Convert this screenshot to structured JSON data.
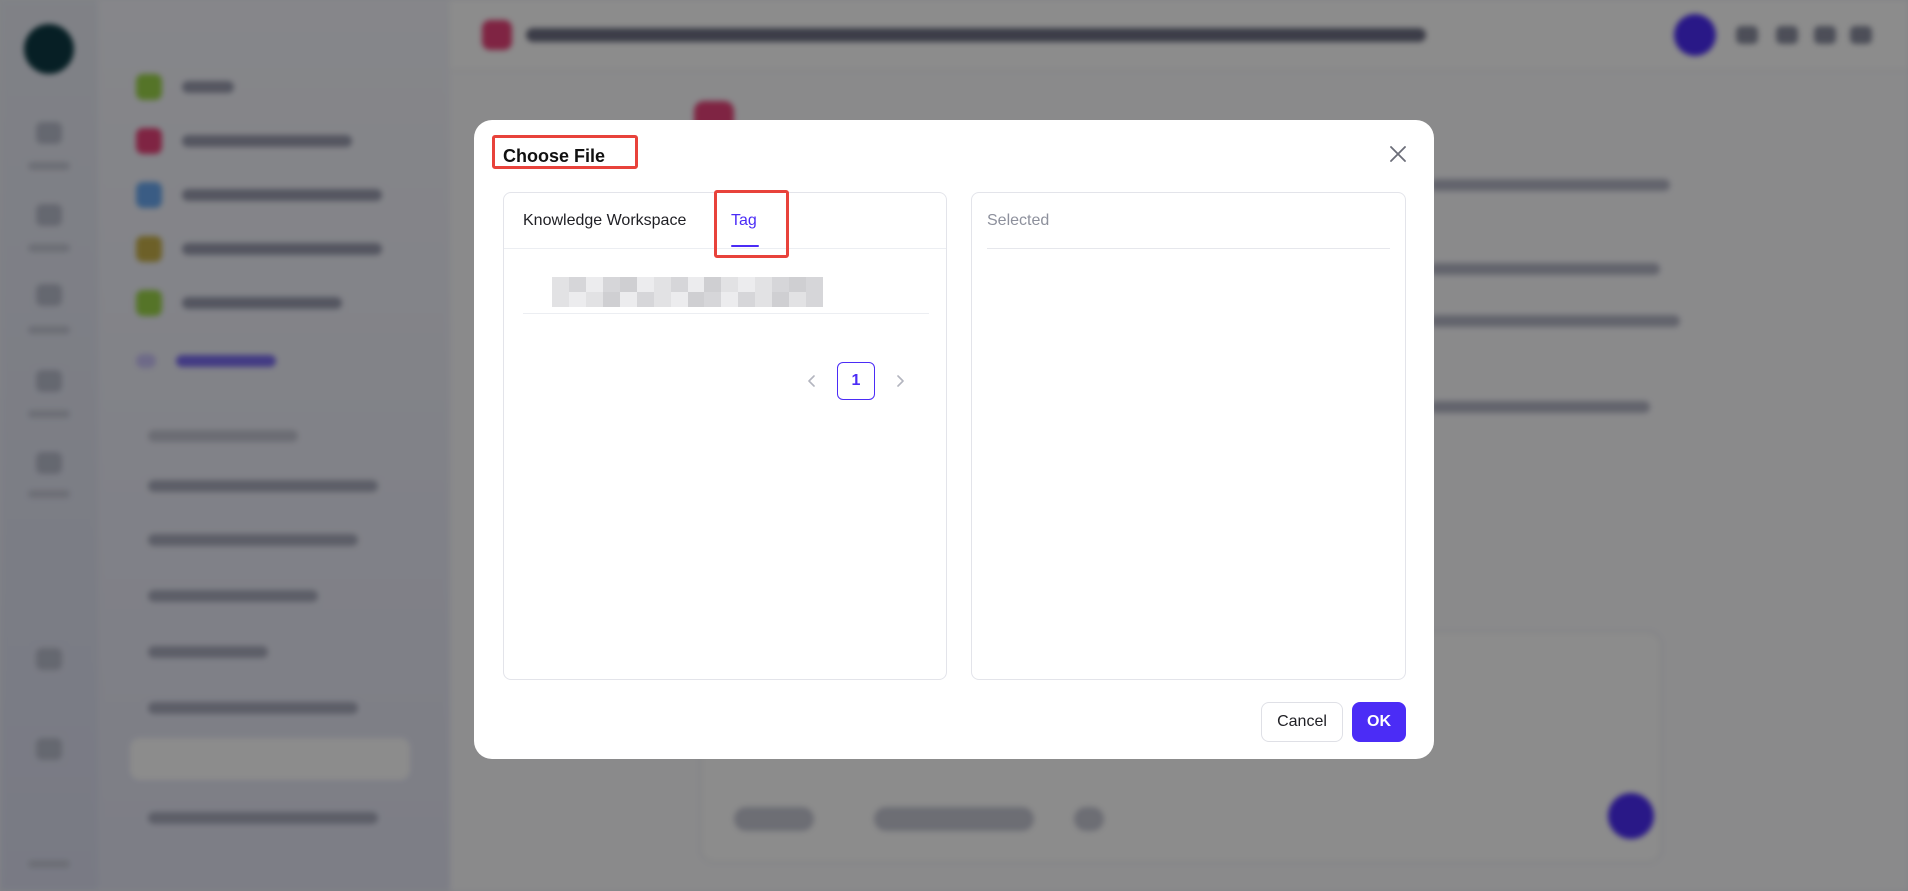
{
  "modal": {
    "title": "Choose File",
    "tabs": [
      {
        "label": "Knowledge Workspace",
        "active": false
      },
      {
        "label": "Tag",
        "active": true
      }
    ],
    "pagination": {
      "current_page": "1"
    },
    "selected_header": "Selected",
    "buttons": {
      "cancel": "Cancel",
      "ok": "OK"
    }
  },
  "colors": {
    "accent": "#4b2cf6",
    "highlight_box": "#e8423b"
  },
  "icons": [
    "close-icon",
    "chevron-left-icon",
    "chevron-right-icon"
  ]
}
